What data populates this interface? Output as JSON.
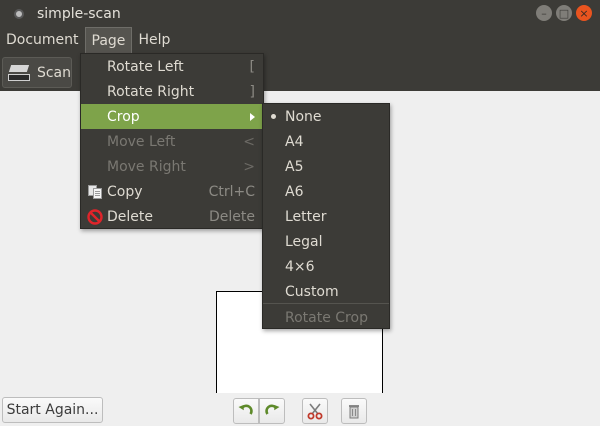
{
  "window": {
    "title": "simple-scan"
  },
  "menubar": {
    "document": "Document",
    "page": "Page",
    "help": "Help"
  },
  "toolbar": {
    "scan_label": "Scan"
  },
  "page_menu": {
    "rotate_left": {
      "label": "Rotate Left",
      "accel": "["
    },
    "rotate_right": {
      "label": "Rotate Right",
      "accel": "]"
    },
    "crop": {
      "label": "Crop"
    },
    "move_left": {
      "label": "Move Left",
      "accel": "<"
    },
    "move_right": {
      "label": "Move Right",
      "accel": ">"
    },
    "copy": {
      "label": "Copy",
      "accel": "Ctrl+C"
    },
    "delete": {
      "label": "Delete",
      "accel": "Delete"
    }
  },
  "crop_menu": {
    "none": "None",
    "a4": "A4",
    "a5": "A5",
    "a6": "A6",
    "letter": "Letter",
    "legal": "Legal",
    "four_by_six": "4×6",
    "custom": "Custom",
    "rotate_crop": "Rotate Crop",
    "selected": "None"
  },
  "bottombar": {
    "start_again": "Start Again..."
  },
  "colors": {
    "accent": "#7ea34a",
    "close": "#e9541f",
    "chrome": "#3c3b37"
  }
}
